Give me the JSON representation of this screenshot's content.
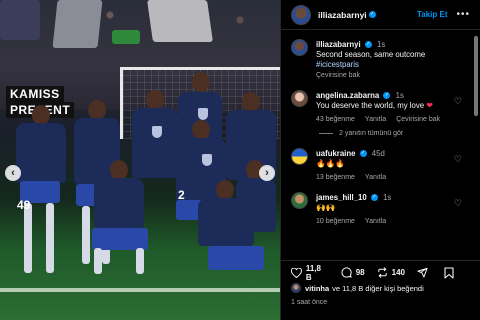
{
  "media": {
    "signs": [
      "KAMISS",
      "PRESENT"
    ],
    "jersey_numbers": [
      "49",
      "2"
    ],
    "prev_glyph": "‹",
    "next_glyph": "›"
  },
  "header": {
    "username": "illiazabarnyi",
    "follow_label": "Takip Et",
    "more_glyph": "•••"
  },
  "caption": {
    "username": "illiazabarnyi",
    "age": "1s",
    "text": "Second season, same outcome",
    "hashtag": "#icicestparis",
    "see_translation": "Çevirisine bak"
  },
  "comments": [
    {
      "username": "angelina.zabarna",
      "age": "1s",
      "text": "You deserve the world, my love",
      "emoji": "❤",
      "likes": "43 beğenme",
      "reply": "Yanıtla",
      "see_translation": "Çevirisine bak",
      "view_replies": "2 yanıtın tümünü gör"
    },
    {
      "username": "uafukraine",
      "age": "45d",
      "text": "🔥🔥🔥",
      "likes": "13 beğenme",
      "reply": "Yanıtla"
    },
    {
      "username": "james_hill_10",
      "age": "1s",
      "text": "🙌🙌",
      "likes": "10 beğenme",
      "reply": "Yanıtla"
    }
  ],
  "actions": {
    "likes_count": "11,8 B",
    "comments_count": "98",
    "shares_count": "140"
  },
  "liked_by": {
    "username": "vitinha",
    "rest": "ve 11,8 B diğer kişi beğendi"
  },
  "timestamp": "1 saat önce",
  "colors": {
    "accent": "#0095f6",
    "background": "#000000",
    "muted": "#a8a8a8",
    "heart": "#ff2d55"
  },
  "icons": {
    "like": "heart-icon",
    "comment": "comment-icon",
    "share": "repost-icon",
    "send": "send-icon",
    "save": "bookmark-icon"
  }
}
